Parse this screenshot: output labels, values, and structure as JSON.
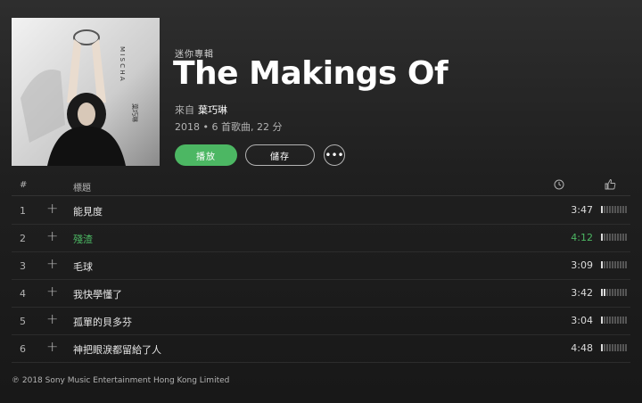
{
  "album": {
    "type_label": "迷你專輯",
    "title": "The Makings Of",
    "by_prefix": "來自",
    "artist": "葉巧琳",
    "info": "2018 • 6 首歌曲, 22 分",
    "cover_text": "M I S C H A",
    "cover_subtext": "葉巧琳"
  },
  "actions": {
    "play_label": "播放",
    "save_label": "儲存",
    "more_label": "•••"
  },
  "table": {
    "col_num": "#",
    "col_title": "標題",
    "clock_icon": "clock-icon",
    "thumb_icon": "thumbs-up-icon"
  },
  "tracks": [
    {
      "num": "1",
      "title": "能見度",
      "duration": "3:47",
      "popularity": 0.1,
      "active": false
    },
    {
      "num": "2",
      "title": "殘渣",
      "duration": "4:12",
      "popularity": 0.1,
      "active": true
    },
    {
      "num": "3",
      "title": "毛球",
      "duration": "3:09",
      "popularity": 0.1,
      "active": false
    },
    {
      "num": "4",
      "title": "我快學懂了",
      "duration": "3:42",
      "popularity": 0.2,
      "active": false
    },
    {
      "num": "5",
      "title": "孤單的貝多芬",
      "duration": "3:04",
      "popularity": 0.1,
      "active": false
    },
    {
      "num": "6",
      "title": "神把眼淚都留給了人",
      "duration": "4:48",
      "popularity": 0.1,
      "active": false
    }
  ],
  "footer": {
    "copyright": "℗ 2018 Sony Music Entertainment Hong Kong Limited"
  },
  "colors": {
    "accent": "#4cb763",
    "background": "#181818"
  }
}
